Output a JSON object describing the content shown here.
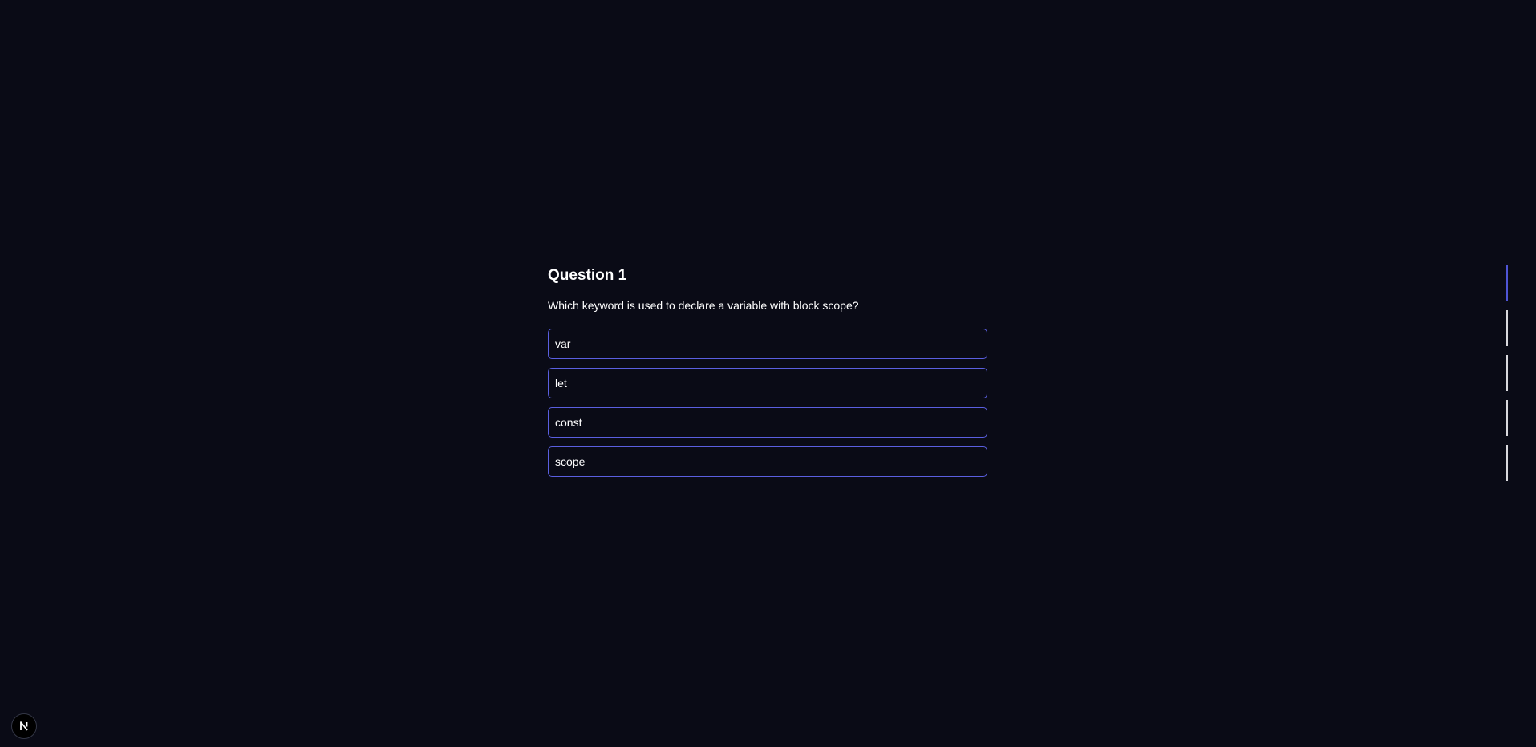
{
  "quiz": {
    "title": "Question 1",
    "text": "Which keyword is used to declare a variable with block scope?",
    "options": [
      {
        "label": "var"
      },
      {
        "label": "let"
      },
      {
        "label": "const"
      },
      {
        "label": "scope"
      }
    ]
  },
  "progress": {
    "total_steps": 5,
    "current_step": 1,
    "active_color": "#4f55d6",
    "inactive_color": "#d9d9dd"
  },
  "devtools": {
    "icon": "nextjs-logo-icon",
    "badge_letter": "N"
  },
  "colors": {
    "background": "#0a0b16",
    "option_border": "#5a5fe0"
  }
}
